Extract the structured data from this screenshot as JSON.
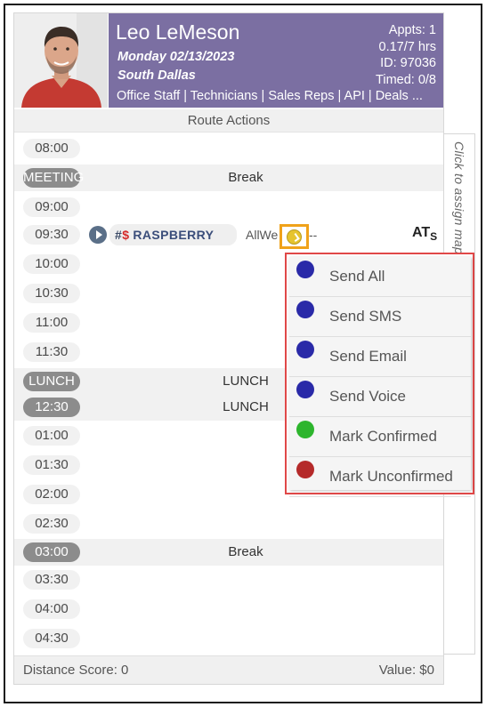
{
  "header": {
    "name": "Leo LeMeson",
    "date": "Monday 02/13/2023",
    "location": "South Dallas",
    "appts": "Appts: 1",
    "hours": "0.17/7 hrs",
    "id": "ID: 97036",
    "timed": "Timed: 0/8",
    "links": "Office Staff | Technicians | Sales Reps | API | Deals ..."
  },
  "route_actions": "Route Actions",
  "assign_strip": "Click to assign map",
  "rows": [
    {
      "time": "08:00",
      "label": ""
    },
    {
      "time": "MEETING",
      "label": "Break"
    },
    {
      "time": "09:00",
      "label": ""
    },
    {
      "time": "09:30",
      "label": ""
    },
    {
      "time": "10:00",
      "label": ""
    },
    {
      "time": "10:30",
      "label": ""
    },
    {
      "time": "11:00",
      "label": ""
    },
    {
      "time": "11:30",
      "label": ""
    },
    {
      "time": "LUNCH",
      "label": "LUNCH"
    },
    {
      "time": "12:30",
      "label": "LUNCH"
    },
    {
      "time": "01:00",
      "label": ""
    },
    {
      "time": "01:30",
      "label": ""
    },
    {
      "time": "02:00",
      "label": ""
    },
    {
      "time": "02:30",
      "label": ""
    },
    {
      "time": "03:00",
      "label": "Break"
    },
    {
      "time": "03:30",
      "label": ""
    },
    {
      "time": "04:00",
      "label": ""
    },
    {
      "time": "04:30",
      "label": ""
    }
  ],
  "appointment": {
    "hash": "#",
    "dollar": "$",
    "name": "RASPBERRY",
    "allwe": "AllWe",
    "dash": "--",
    "at": "AT",
    "at_sub": "S"
  },
  "menu": {
    "items": [
      {
        "label": "Send All",
        "color": "#2a2aa8"
      },
      {
        "label": "Send SMS",
        "color": "#2a2aa8"
      },
      {
        "label": "Send Email",
        "color": "#2a2aa8"
      },
      {
        "label": "Send Voice",
        "color": "#2a2aa8"
      },
      {
        "label": "Mark Confirmed",
        "color": "#2db52d"
      },
      {
        "label": "Mark Unconfirmed",
        "color": "#b52a2a"
      }
    ]
  },
  "footer": {
    "distance": "Distance Score: 0",
    "value": "Value: $0"
  },
  "colors": {
    "header_bg": "#7b6fa2",
    "highlight": "#f0a21a",
    "menu_border": "#e04848"
  }
}
